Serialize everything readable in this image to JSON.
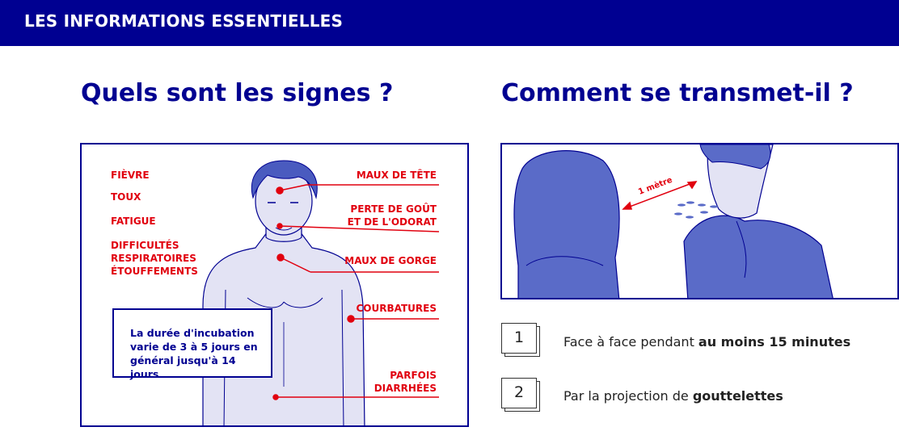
{
  "banner": {
    "title": "LES INFORMATIONS ESSENTIELLES"
  },
  "left_section": {
    "heading": "Quels sont les signes ?",
    "symptoms_left": [
      "FIÈVRE",
      "TOUX",
      "FATIGUE",
      "DIFFICULTÉS",
      "RESPIRATOIRES",
      "ÉTOUFFEMENTS"
    ],
    "symptoms_right": [
      "MAUX DE TÊTE",
      "PERTE DE GOÛT",
      "ET DE L'ODORAT",
      "MAUX DE GORGE",
      "COURBATURES",
      "PARFOIS",
      "DIARRHÉES"
    ],
    "incubation": [
      "La durée d'incubation",
      "varie de 3 à 5 jours en",
      "général jusqu'à 14 jours"
    ]
  },
  "right_section": {
    "heading": "Comment se transmet-il ?",
    "distance_label": "1 mètre",
    "steps": [
      {
        "number": "1",
        "text": "Face à face pendant ",
        "bold": "au moins 15 minutes"
      },
      {
        "number": "2",
        "text": "Par la projection de ",
        "bold": "gouttelettes"
      }
    ]
  },
  "colors": {
    "navy": "#000091",
    "red": "#e1000f",
    "body_fill": "#e3e3f4",
    "blue_fill": "#5a6bc8"
  }
}
